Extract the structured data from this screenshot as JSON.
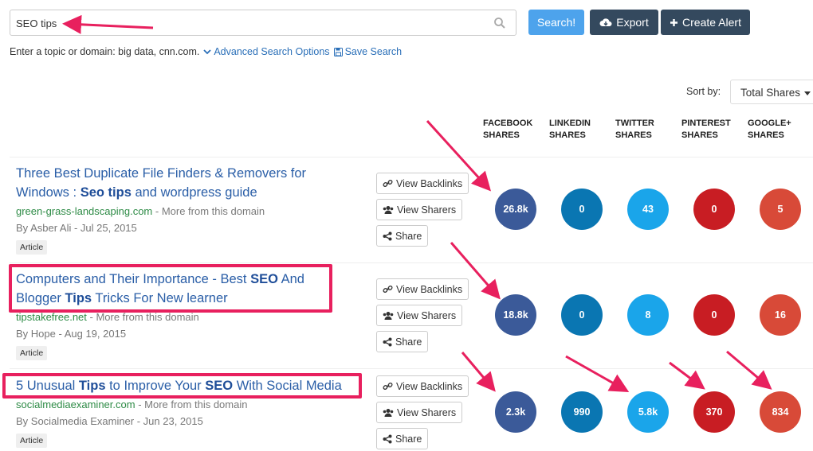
{
  "search": {
    "value": "SEO tips",
    "button_label": "Search!",
    "export_label": "Export",
    "alert_label": "Create Alert"
  },
  "hint": {
    "text": "Enter a topic or domain: big data, cnn.com.",
    "advanced_label": "Advanced Search Options",
    "save_label": "Save Search"
  },
  "sort": {
    "label": "Sort by:",
    "selected": "Total Shares"
  },
  "columns": [
    {
      "line1": "FACEBOOK",
      "line2": "SHARES"
    },
    {
      "line1": "LINKEDIN",
      "line2": "SHARES"
    },
    {
      "line1": "TWITTER",
      "line2": "SHARES"
    },
    {
      "line1": "PINTEREST",
      "line2": "SHARES"
    },
    {
      "line1": "GOOGLE+",
      "line2": "SHARES"
    }
  ],
  "row_buttons": {
    "backlinks": "View Backlinks",
    "sharers": "View Sharers",
    "share": "Share"
  },
  "results": [
    {
      "title_parts": [
        {
          "text": "Three Best Duplicate File Finders & Removers for Windows : ",
          "bold": false
        },
        {
          "text": "Seo tips",
          "bold": true
        },
        {
          "text": " and wordpress guide",
          "bold": false
        }
      ],
      "domain": "green-grass-landscaping.com",
      "more": " - More from this domain",
      "byline": "By Asber Ali - Jul 25, 2015",
      "tag": "Article",
      "shares": [
        "26.8k",
        "0",
        "43",
        "0",
        "5"
      ]
    },
    {
      "title_parts": [
        {
          "text": "Computers and Their Importance - Best ",
          "bold": false
        },
        {
          "text": "SEO",
          "bold": true
        },
        {
          "text": " And Blogger ",
          "bold": false
        },
        {
          "text": "Tips",
          "bold": true
        },
        {
          "text": " Tricks For New learner",
          "bold": false
        }
      ],
      "domain": "tipstakefree.net",
      "more": " - More from this domain",
      "byline": "By Hope - Aug 19, 2015",
      "tag": "Article",
      "shares": [
        "18.8k",
        "0",
        "8",
        "0",
        "16"
      ]
    },
    {
      "title_parts": [
        {
          "text": "5 Unusual ",
          "bold": false
        },
        {
          "text": "Tips",
          "bold": true
        },
        {
          "text": " to Improve Your ",
          "bold": false
        },
        {
          "text": "SEO",
          "bold": true
        },
        {
          "text": " With Social Media",
          "bold": false
        }
      ],
      "domain": "socialmediaexaminer.com",
      "more": " - More from this domain",
      "byline": "By Socialmedia Examiner - Jun 23, 2015",
      "tag": "Article",
      "shares": [
        "2.3k",
        "990",
        "5.8k",
        "370",
        "834"
      ]
    }
  ],
  "colors": {
    "facebook": "#3b5a99",
    "linkedin": "#0a76b2",
    "twitter": "#1aa5ea",
    "pinterest": "#c81d23",
    "googleplus": "#d84a38",
    "annotation": "#e8205e",
    "search_button": "#4da3ec",
    "dark_button": "#34495e"
  }
}
